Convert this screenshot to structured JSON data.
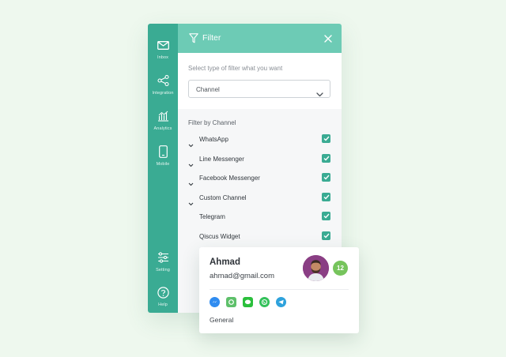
{
  "sidebar": {
    "items": [
      {
        "label": "Inbox",
        "icon": "mail-icon"
      },
      {
        "label": "Integration",
        "icon": "share-nodes-icon"
      },
      {
        "label": "Analytics",
        "icon": "chart-icon"
      },
      {
        "label": "Mobile",
        "icon": "phone-icon"
      },
      {
        "label": "Setting",
        "icon": "sliders-icon"
      },
      {
        "label": "Help",
        "icon": "help-icon"
      }
    ]
  },
  "filter_panel": {
    "title": "Filter",
    "prompt": "Select type of filter what you want",
    "select_value": "Channel",
    "section_title": "Filter by Channel",
    "channels": [
      {
        "name": "WhatsApp",
        "expandable": true,
        "checked": true
      },
      {
        "name": "Line Messenger",
        "expandable": true,
        "checked": true
      },
      {
        "name": "Facebook Messenger",
        "expandable": true,
        "checked": true
      },
      {
        "name": "Custom Channel",
        "expandable": true,
        "checked": true
      },
      {
        "name": "Telegram",
        "expandable": false,
        "checked": true
      },
      {
        "name": "Qiscus Widget",
        "expandable": false,
        "checked": true
      }
    ]
  },
  "contact_card": {
    "name": "Ahmad",
    "email": "ahmad@gmail.com",
    "count": "12",
    "channel_icons": [
      "messenger-icon",
      "qiscus-icon",
      "line-icon",
      "whatsapp-icon",
      "telegram-icon"
    ],
    "group": "General"
  },
  "colors": {
    "sidebar": "#3aab93",
    "header": "#6dcbb5",
    "checkbox": "#3aab93",
    "badge": "#76c45c",
    "background": "#eef8ee"
  }
}
